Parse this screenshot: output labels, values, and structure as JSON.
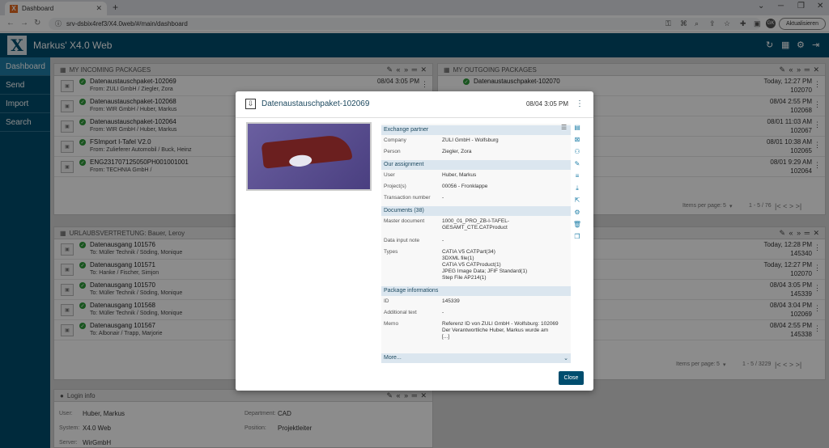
{
  "browser": {
    "tab_title": "Dashboard",
    "url": "srv-dsbix4ref3/X4.0web/#/main/dashboard",
    "update_label": "Aktualisieren",
    "profile_initials": "GK"
  },
  "app": {
    "logo": "X",
    "title": "Markus'  X4.0 Web"
  },
  "sidebar": {
    "items": [
      {
        "label": "Dashboard"
      },
      {
        "label": "Send"
      },
      {
        "label": "Import"
      },
      {
        "label": "Search"
      }
    ]
  },
  "incoming": {
    "title": "MY INCOMING PACKAGES",
    "rows": [
      {
        "name": "Datenaustauschpaket-102069",
        "from": "From: ZULI GmbH / Ziegler, Zora",
        "date": "08/04 3:05 PM"
      },
      {
        "name": "Datenaustauschpaket-102068",
        "from": "From: WIR GmbH / Huber, Markus",
        "date": "08/04 2:55 PM"
      },
      {
        "name": "Datenaustauschpaket-102064",
        "from": "From: WIR GmbH / Huber, Markus",
        "date": "08/01 11:03 AM"
      },
      {
        "name": "FSImport I-Tafel V2.0",
        "from": "From: Zulieferer Automobil / Buck, Heinz",
        "date": "08/01 10:38 AM"
      },
      {
        "name": "ENG231707125050PH001001001",
        "from": "From: TECHNIA GmbH /",
        "date": "08/01 9:29 AM"
      }
    ]
  },
  "outgoing": {
    "title": "MY OUTGOING PACKAGES",
    "rows": [
      {
        "name": "Datenaustauschpaket-102070",
        "date": "Today, 12:27 PM",
        "id": "102070"
      },
      {
        "date": "08/04 2:55 PM",
        "id": "102068"
      },
      {
        "date": "08/01 11:03 AM",
        "id": "102067"
      },
      {
        "date": "08/01 10:38 AM",
        "id": "102065"
      },
      {
        "date": "08/01 9:29 AM",
        "id": "102064"
      }
    ],
    "items_per_page_label": "Items per page:",
    "items_per_page": "5",
    "range": "1 - 5 / 76"
  },
  "vacation": {
    "title": "URLAUBSVERTRETUNG: Bauer, Leroy",
    "rows": [
      {
        "name": "Datenausgang 101576",
        "to": "To: Müller Technik / Söding, Monique",
        "date": "Today, 12:28 PM",
        "id": "145340"
      },
      {
        "name": "Datenausgang 101571",
        "to": "To: Hanke / Fischer, Simjon",
        "date": "Today, 12:27 PM",
        "id": "102070"
      },
      {
        "name": "Datenausgang 101570",
        "to": "To: Müller Technik / Söding, Monique",
        "date": "08/04 3:05 PM",
        "id": "145339"
      },
      {
        "name": "Datenausgang 101568",
        "to": "To: Müller Technik / Söding, Monique",
        "date": "08/04 3:04 PM",
        "id": "102069"
      },
      {
        "name": "Datenausgang 101567",
        "to": "To: Albonair / Trapp, Marjorie",
        "date": "08/04 2:55 PM",
        "id": "145338"
      }
    ],
    "items_per_page_label": "Items per page:",
    "items_per_page": "5",
    "range": "1 - 5 / 3229"
  },
  "login": {
    "title": "Login info",
    "user_label": "User:",
    "user": "Huber, Markus",
    "system_label": "System:",
    "system": "X4.0 Web",
    "server_label": "Server:",
    "server": "WirGmbH",
    "department_label": "Department:",
    "department": "CAD",
    "position_label": "Position:",
    "position": "Projektleiter"
  },
  "modal": {
    "title": "Datenaustauschpaket-102069",
    "date": "08/04 3:05 PM",
    "sections": {
      "exchange": "Exchange partner",
      "assignment": "Our assignment",
      "documents": "Documents (38)",
      "package": "Package informations"
    },
    "company_label": "Company",
    "company": "ZULI GmbH - Wolfsburg",
    "person_label": "Person",
    "person": "Ziegler, Zora",
    "user_label": "User",
    "user": "Huber, Markus",
    "project_label": "Project(s)",
    "project": "00056 - Fronklappe",
    "transaction_label": "Transaction number",
    "transaction": "-",
    "master_label": "Master document",
    "master": "1000_01_PRO_ZB-I-TAFEL-GESAMT_CTE.CATProduct",
    "note_label": "Data input note",
    "note": "-",
    "types_label": "Types",
    "types": [
      "CATIA V5 CATPart(34)",
      "3DXML file(1)",
      "CATIA V5 CATProduct(1)",
      "JPEG Image Data; JFIF Standard(1)",
      "Step File AP214(1)"
    ],
    "id_label": "ID",
    "id": "145339",
    "additional_label": "Additional text",
    "additional": "-",
    "memo_label": "Memo",
    "memo": [
      "Referenz ID von ZULI GmbH - Wolfsburg: 102069",
      "Der Verantwortliche Huber, Markus wurde am",
      "[...]"
    ],
    "more": "More...",
    "close": "Close"
  }
}
